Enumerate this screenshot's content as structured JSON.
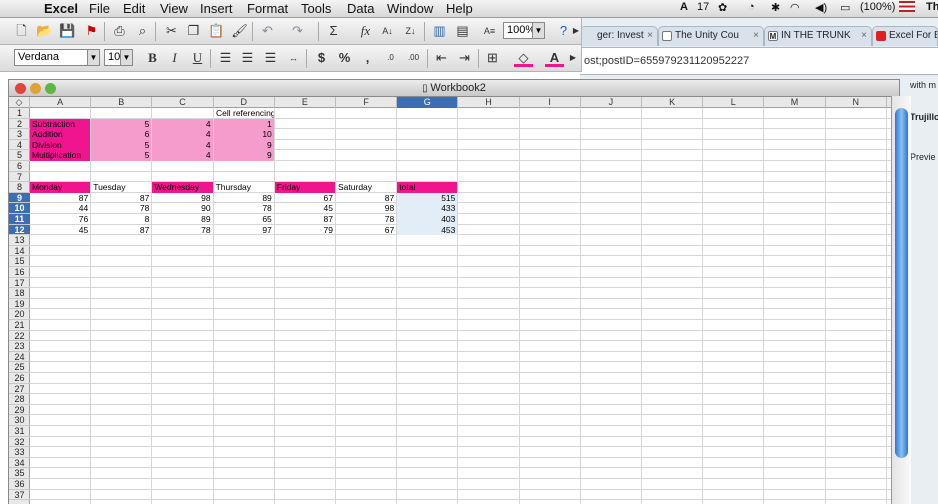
{
  "menubar": {
    "app": "Excel",
    "items": [
      "File",
      "Edit",
      "View",
      "Insert",
      "Format",
      "Tools",
      "Data",
      "Window",
      "Help"
    ],
    "status": {
      "adobe": "17",
      "battery": "(100%)",
      "clock": "Th"
    }
  },
  "browser": {
    "tabs": [
      {
        "label": "ger: Invest"
      },
      {
        "label": "The Unity Cou"
      },
      {
        "label": "IN THE TRUNK"
      },
      {
        "label": "Excel For B"
      }
    ],
    "url": "ost;postID=655979231120952227",
    "side_texts": {
      "a": "with m",
      "b": "Trujillo",
      "c": "Previe"
    }
  },
  "toolbar": {
    "zoom": "100%",
    "font_name": "Verdana",
    "font_size": "10"
  },
  "workbook": {
    "title": "Workbook2",
    "columns": [
      "A",
      "B",
      "C",
      "D",
      "E",
      "F",
      "G",
      "H",
      "I",
      "J",
      "K",
      "L",
      "M",
      "N"
    ],
    "row_count": 37,
    "title_cell": "Cell referencing",
    "ops": [
      {
        "label": "Subtraction",
        "b": "5",
        "c": "4",
        "d": "1"
      },
      {
        "label": "Addition",
        "b": "6",
        "c": "4",
        "d": "10"
      },
      {
        "label": "Division",
        "b": "5",
        "c": "4",
        "d": "9"
      },
      {
        "label": "Multiplication",
        "b": "5",
        "c": "4",
        "d": "9"
      }
    ],
    "day_headers": [
      "Monday",
      "Tuesday",
      "Wednesday",
      "Thursday",
      "Friday",
      "Saturday",
      "total"
    ],
    "day_rows": [
      [
        "87",
        "87",
        "98",
        "89",
        "67",
        "87",
        "515"
      ],
      [
        "44",
        "78",
        "90",
        "78",
        "45",
        "98",
        "433"
      ],
      [
        "76",
        "8",
        "89",
        "65",
        "87",
        "78",
        "403"
      ],
      [
        "45",
        "87",
        "78",
        "97",
        "79",
        "67",
        "453"
      ]
    ]
  },
  "colors": {
    "magenta": "#f0158f",
    "pink": "#f59ccd",
    "selection": "#3c6eb4",
    "scroll": "#2a78d4"
  }
}
